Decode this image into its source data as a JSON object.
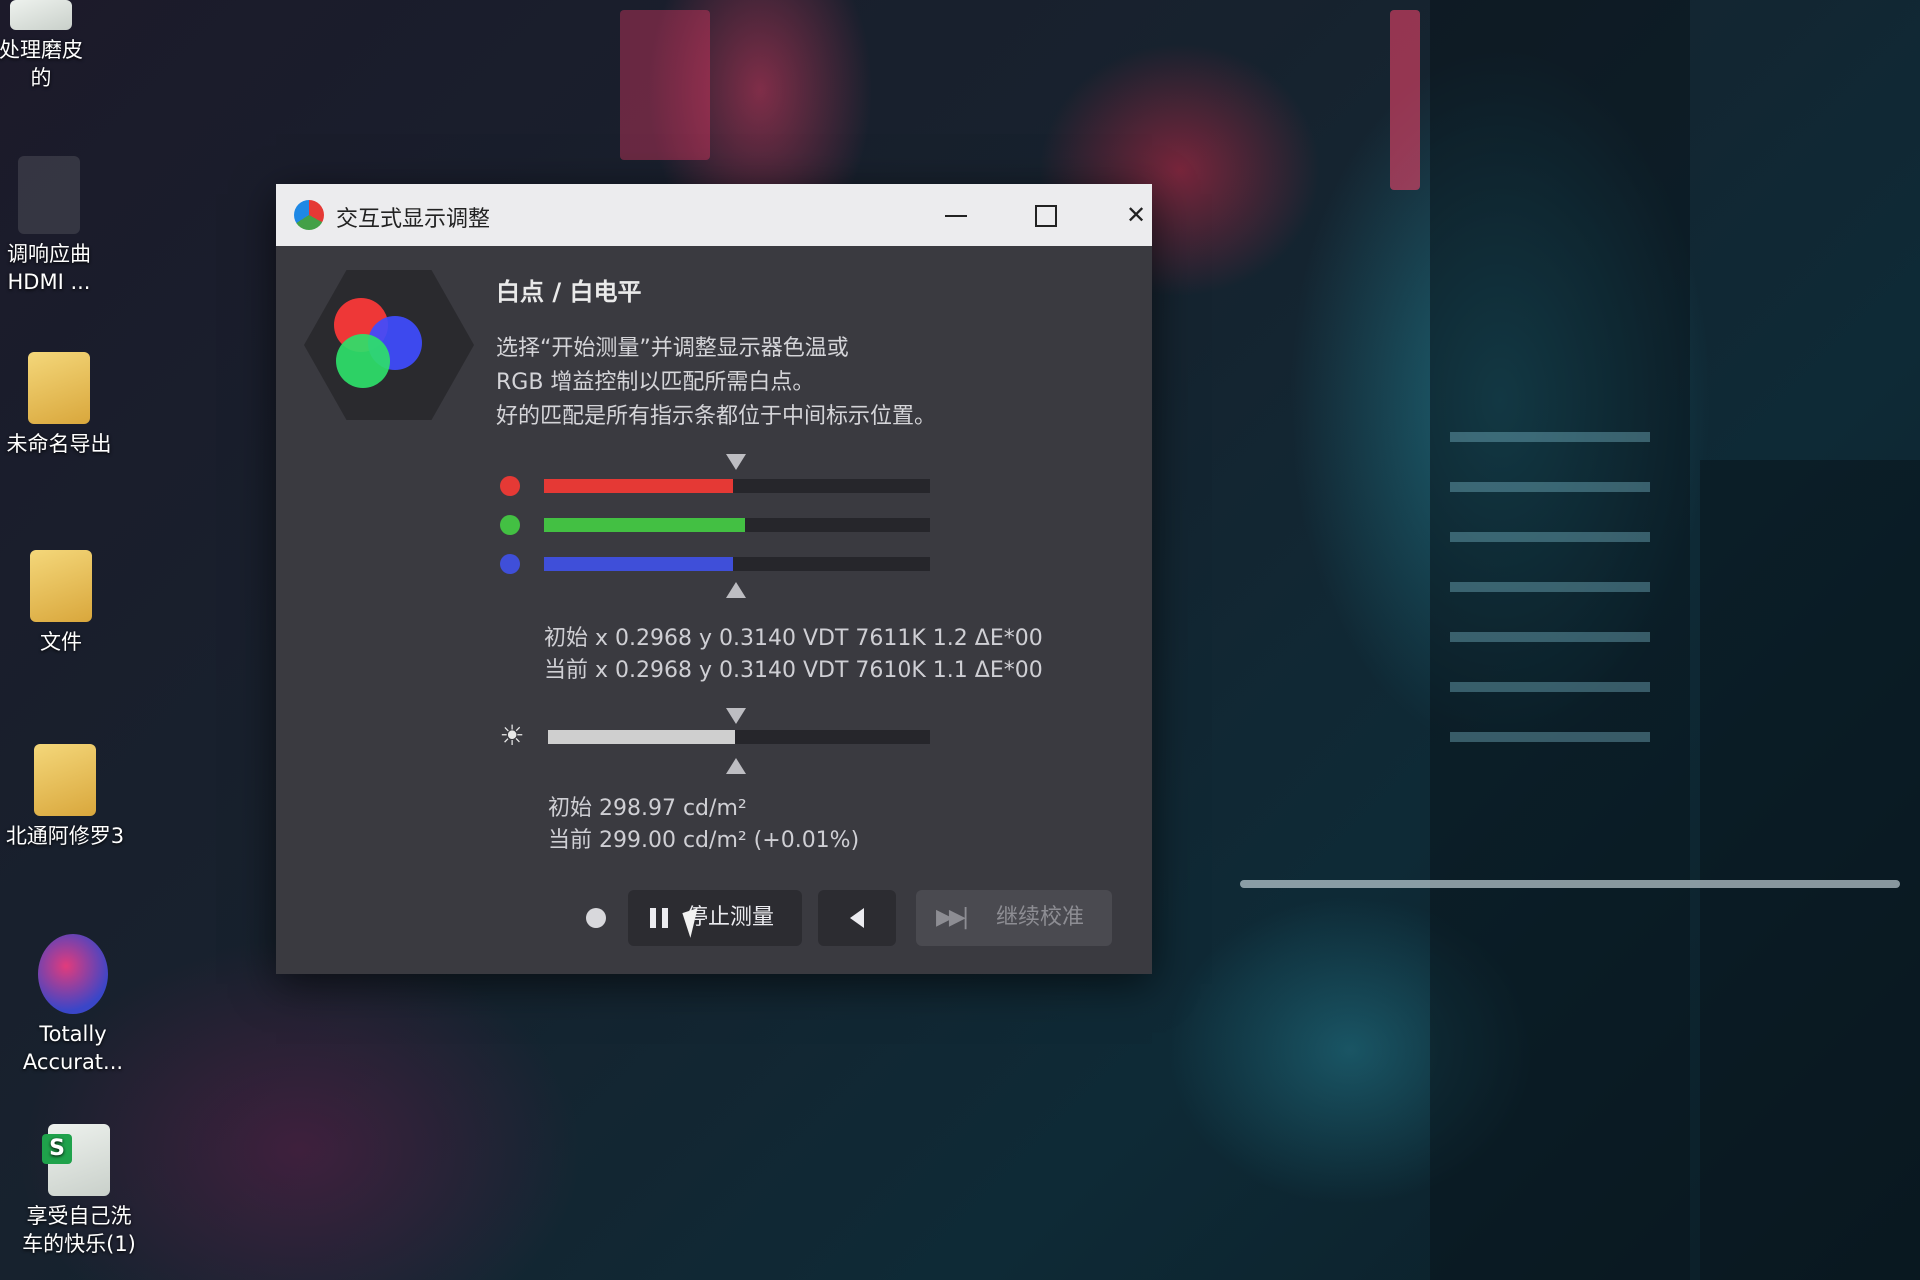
{
  "desktop": {
    "icons": [
      {
        "label_line1": "处理磨皮",
        "label_line2": "的",
        "icon": "photo-editor-icon"
      },
      {
        "label_line1": "调响应曲",
        "label_line2": "HDMI ...",
        "icon": "file-icon"
      },
      {
        "label_line1": "未命名导出",
        "label_line2": "",
        "icon": "document-icon"
      },
      {
        "label_line1": "文件",
        "label_line2": "",
        "icon": "folder-icon"
      },
      {
        "label_line1": "北通阿修罗3",
        "label_line2": "",
        "icon": "folder-icon"
      },
      {
        "label_line1": "Totally",
        "label_line2": "Accurat...",
        "icon": "game-mask-icon"
      },
      {
        "label_line1": "享受自己洗",
        "label_line2": "车的快乐(1)",
        "icon": "spreadsheet-icon"
      }
    ]
  },
  "window": {
    "title": "交互式显示调整",
    "controls": {
      "minimize": "minimize",
      "maximize": "maximize",
      "close": "close"
    }
  },
  "content": {
    "heading": "白点 / 白电平",
    "description_lines": [
      "选择“开始测量”并调整显示器色温或",
      "RGB 增益控制以匹配所需白点。",
      "好的匹配是所有指示条都位于中间标示位置。"
    ],
    "rgb_bars": [
      {
        "channel": "red",
        "color": "#e53935",
        "level": 0.49
      },
      {
        "channel": "green",
        "color": "#43c043",
        "level": 0.52
      },
      {
        "channel": "blue",
        "color": "#3f4fd9",
        "level": 0.49
      }
    ],
    "white_point": {
      "initial": "初始 x 0.2968 y 0.3140 VDT 7611K 1.2 ΔE*00",
      "current": "当前 x 0.2968 y 0.3140 VDT 7610K 1.1 ΔE*00"
    },
    "luminance_bar": {
      "level": 0.49,
      "color": "#cfcfcf"
    },
    "luminance": {
      "initial": "初始 298.97 cd/m²",
      "current": "当前 299.00 cd/m² (+0.01%)"
    }
  },
  "buttons": {
    "stop_measure": "停止测量",
    "continue_calibration": "继续校准"
  }
}
